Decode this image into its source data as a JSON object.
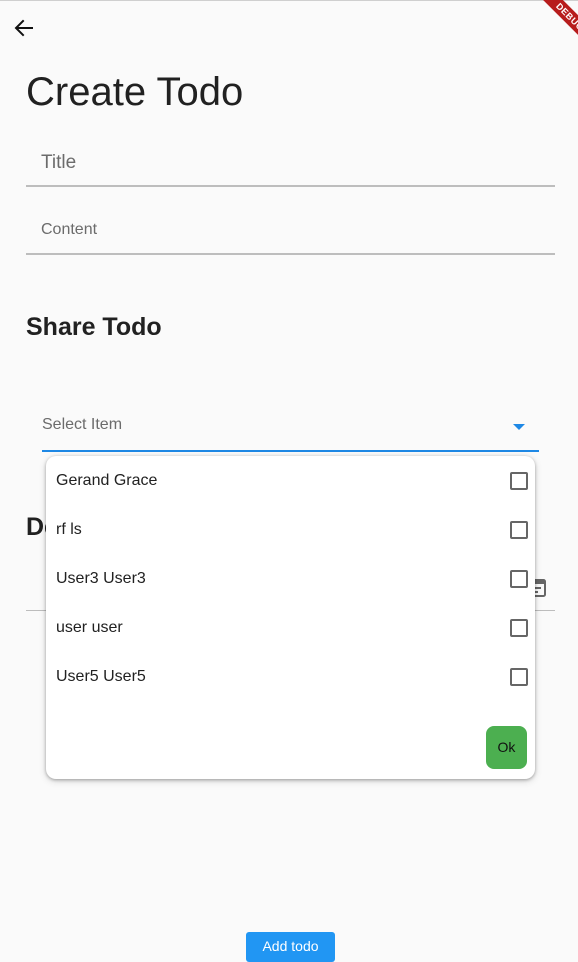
{
  "app": {
    "debug_banner": "DEBUG",
    "page_title": "Create Todo"
  },
  "form": {
    "title_placeholder": "Title",
    "content_placeholder": "Content"
  },
  "share": {
    "section_title": "Share Todo",
    "select_placeholder": "Select Item",
    "options": [
      {
        "label": "Gerand Grace",
        "checked": false
      },
      {
        "label": "rf ls",
        "checked": false
      },
      {
        "label": "User3 User3",
        "checked": false
      },
      {
        "label": "user user",
        "checked": false
      },
      {
        "label": "User5 User5",
        "checked": false
      }
    ],
    "ok_label": "Ok"
  },
  "date_section": {
    "title_visible_fragment": "De"
  },
  "footer": {
    "add_button_label": "Add todo"
  },
  "colors": {
    "accent": "#1e88e5",
    "ok_button": "#4caf50",
    "add_button": "#2196f3",
    "debug_ribbon": "#b71c1c"
  },
  "icons": {
    "back": "arrow-back-icon",
    "calendar": "calendar-icon",
    "dropdown": "caret-down-icon"
  }
}
